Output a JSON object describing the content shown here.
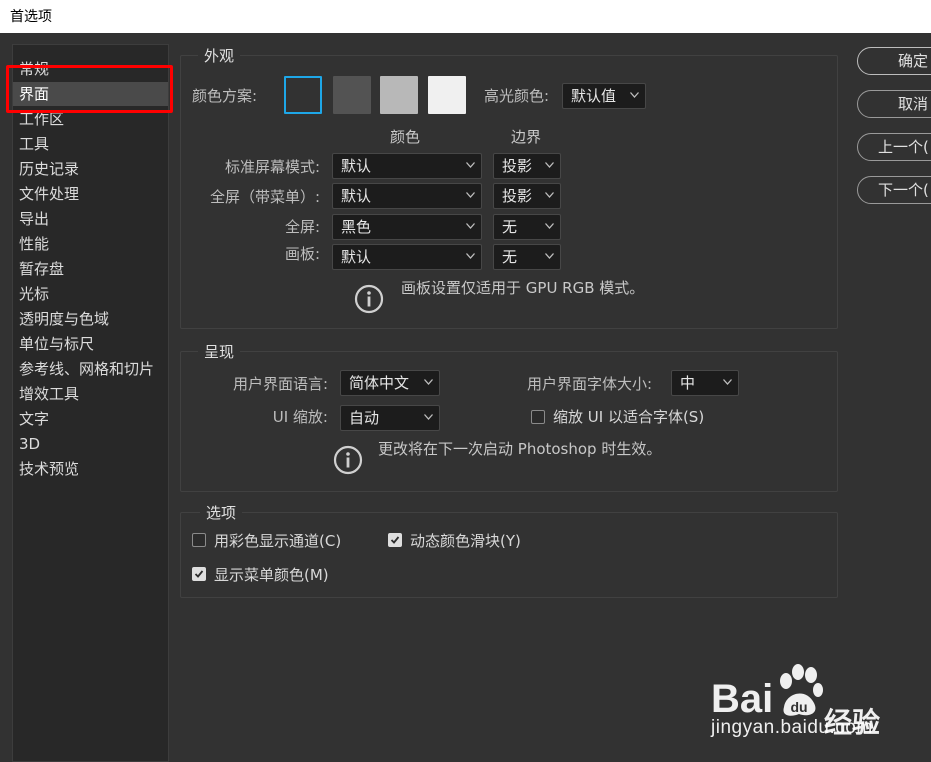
{
  "window": {
    "title": "首选项"
  },
  "sidebar": {
    "items": [
      {
        "label": "常规"
      },
      {
        "label": "界面"
      },
      {
        "label": "工作区"
      },
      {
        "label": "工具"
      },
      {
        "label": "历史记录"
      },
      {
        "label": "文件处理"
      },
      {
        "label": "导出"
      },
      {
        "label": "性能"
      },
      {
        "label": "暂存盘"
      },
      {
        "label": "光标"
      },
      {
        "label": "透明度与色域"
      },
      {
        "label": "单位与标尺"
      },
      {
        "label": "参考线、网格和切片"
      },
      {
        "label": "增效工具"
      },
      {
        "label": "文字"
      },
      {
        "label": "3D"
      },
      {
        "label": "技术预览"
      }
    ],
    "selected": "界面"
  },
  "appearance": {
    "title": "外观",
    "color_scheme_label": "颜色方案:",
    "swatches": [
      {
        "name": "darkest",
        "color": "#323232",
        "selected": true
      },
      {
        "name": "dark",
        "color": "#535353",
        "selected": false
      },
      {
        "name": "medium",
        "color": "#b8b8b8",
        "selected": false
      },
      {
        "name": "light",
        "color": "#f0f0f0",
        "selected": false
      }
    ],
    "highlight_label": "高光颜色:",
    "highlight_value": "默认值",
    "col_color": "颜色",
    "col_border": "边界",
    "rows": [
      {
        "label": "标准屏幕模式:",
        "color": "默认",
        "border": "投影"
      },
      {
        "label": "全屏（带菜单）:",
        "color": "默认",
        "border": "投影"
      },
      {
        "label": "全屏:",
        "color": "黑色",
        "border": "无"
      },
      {
        "label": "画板:",
        "color": "默认",
        "border": "无"
      }
    ],
    "note": "画板设置仅适用于 GPU RGB 模式。"
  },
  "presentation": {
    "title": "呈现",
    "ui_language_label": "用户界面语言:",
    "ui_language_value": "简体中文",
    "ui_font_size_label": "用户界面字体大小:",
    "ui_font_size_value": "中",
    "ui_scale_label": "UI 缩放:",
    "ui_scale_value": "自动",
    "scale_to_font_label": "缩放 UI 以适合字体(S)",
    "scale_to_font_checked": false,
    "note": "更改将在下一次启动 Photoshop 时生效。"
  },
  "options": {
    "title": "选项",
    "color_channels_label": "用彩色显示通道(C)",
    "color_channels_checked": false,
    "dynamic_sliders_label": "动态颜色滑块(Y)",
    "dynamic_sliders_checked": true,
    "menu_colors_label": "显示菜单颜色(M)",
    "menu_colors_checked": true
  },
  "buttons": {
    "ok": "确定",
    "cancel": "取消",
    "prev": "上一个(",
    "next": "下一个("
  },
  "watermark": {
    "brand_left": "Bai",
    "brand_right": "经验",
    "url": "jingyan.baidu.com"
  },
  "colors": {
    "panel_bg": "#323232",
    "sidebar_bg": "#282828",
    "selected_item": "#4a4a4a",
    "highlight_red": "#ff0000",
    "swatch_selected_border": "#1ea7e8"
  }
}
